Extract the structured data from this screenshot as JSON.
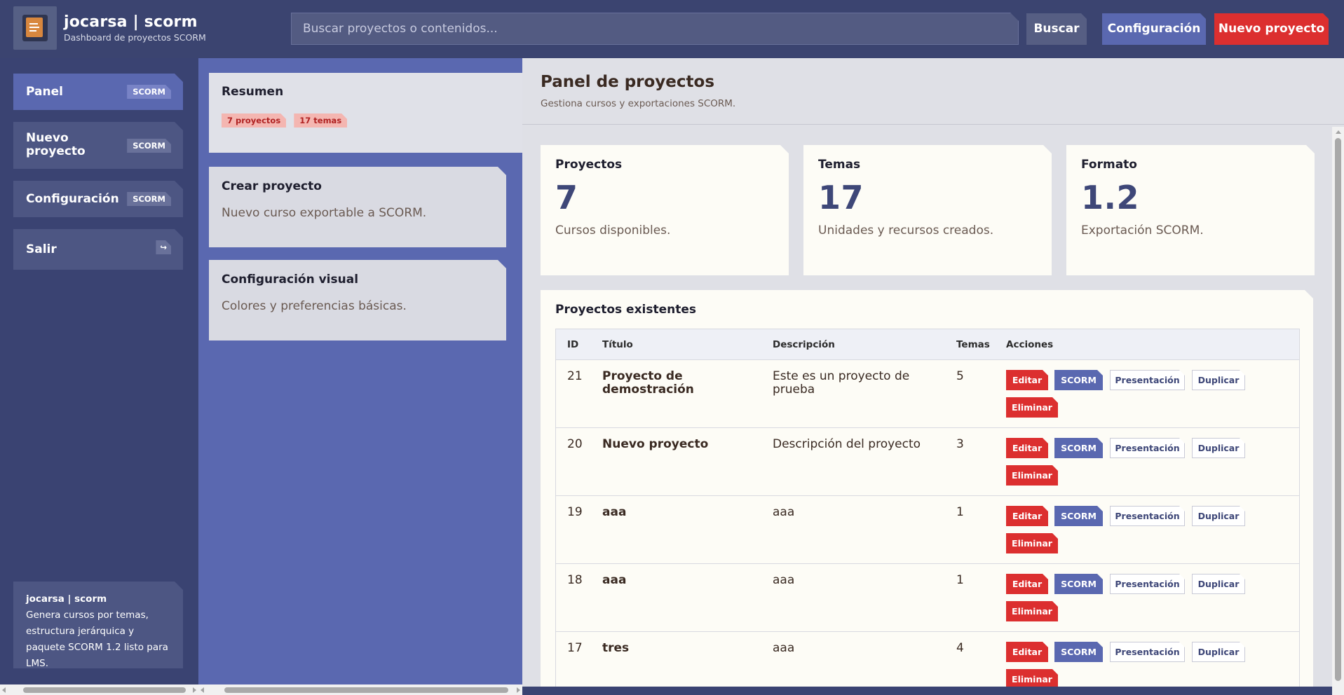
{
  "header": {
    "title": "jocarsa | scorm",
    "subtitle": "Dashboard de proyectos SCORM",
    "search_placeholder": "Buscar proyectos o contenidos...",
    "search_button": "Buscar",
    "config_button": "Configuración",
    "new_button": "Nuevo proyecto",
    "logo_icon": "document-icon"
  },
  "sidebar": {
    "items": [
      {
        "label": "Panel",
        "tag": "SCORM"
      },
      {
        "label": "Nuevo proyecto",
        "tag": "SCORM"
      },
      {
        "label": "Configuración",
        "tag": "SCORM"
      },
      {
        "label": "Salir",
        "tag": "↪"
      }
    ],
    "about": {
      "title": "jocarsa | scorm",
      "text": "Genera cursos por temas, estructura jerárquica y paquete SCORM 1.2 listo para LMS."
    }
  },
  "middle": {
    "summary": {
      "title": "Resumen",
      "pill_projects": "7 proyectos",
      "pill_topics": "17 temas"
    },
    "create": {
      "title": "Crear proyecto",
      "text": "Nuevo curso exportable a SCORM."
    },
    "visual": {
      "title": "Configuración visual",
      "text": "Colores y preferencias básicas."
    }
  },
  "main": {
    "title": "Panel de proyectos",
    "subtitle": "Gestiona cursos y exportaciones SCORM.",
    "stats": [
      {
        "label": "Proyectos",
        "value": "7",
        "desc": "Cursos disponibles."
      },
      {
        "label": "Temas",
        "value": "17",
        "desc": "Unidades y recursos creados."
      },
      {
        "label": "Formato",
        "value": "1.2",
        "desc": "Exportación SCORM."
      }
    ],
    "table": {
      "title": "Proyectos existentes",
      "columns": [
        "ID",
        "Título",
        "Descripción",
        "Temas",
        "Acciones"
      ],
      "actions": {
        "edit": "Editar",
        "scorm": "SCORM",
        "present": "Presentación",
        "duplicate": "Duplicar",
        "delete": "Eliminar"
      },
      "rows": [
        {
          "id": "21",
          "title": "Proyecto de demostración",
          "desc": "Este es un proyecto de prueba",
          "topics": "5"
        },
        {
          "id": "20",
          "title": "Nuevo proyecto",
          "desc": "Descripción del proyecto",
          "topics": "3"
        },
        {
          "id": "19",
          "title": "aaa",
          "desc": "aaa",
          "topics": "1"
        },
        {
          "id": "18",
          "title": "aaa",
          "desc": "aaa",
          "topics": "1"
        },
        {
          "id": "17",
          "title": "tres",
          "desc": "aaa",
          "topics": "4"
        }
      ]
    }
  },
  "colors": {
    "accent": "#5a68b0",
    "danger": "#dc2f2f",
    "sidebar": "#3a4372"
  }
}
